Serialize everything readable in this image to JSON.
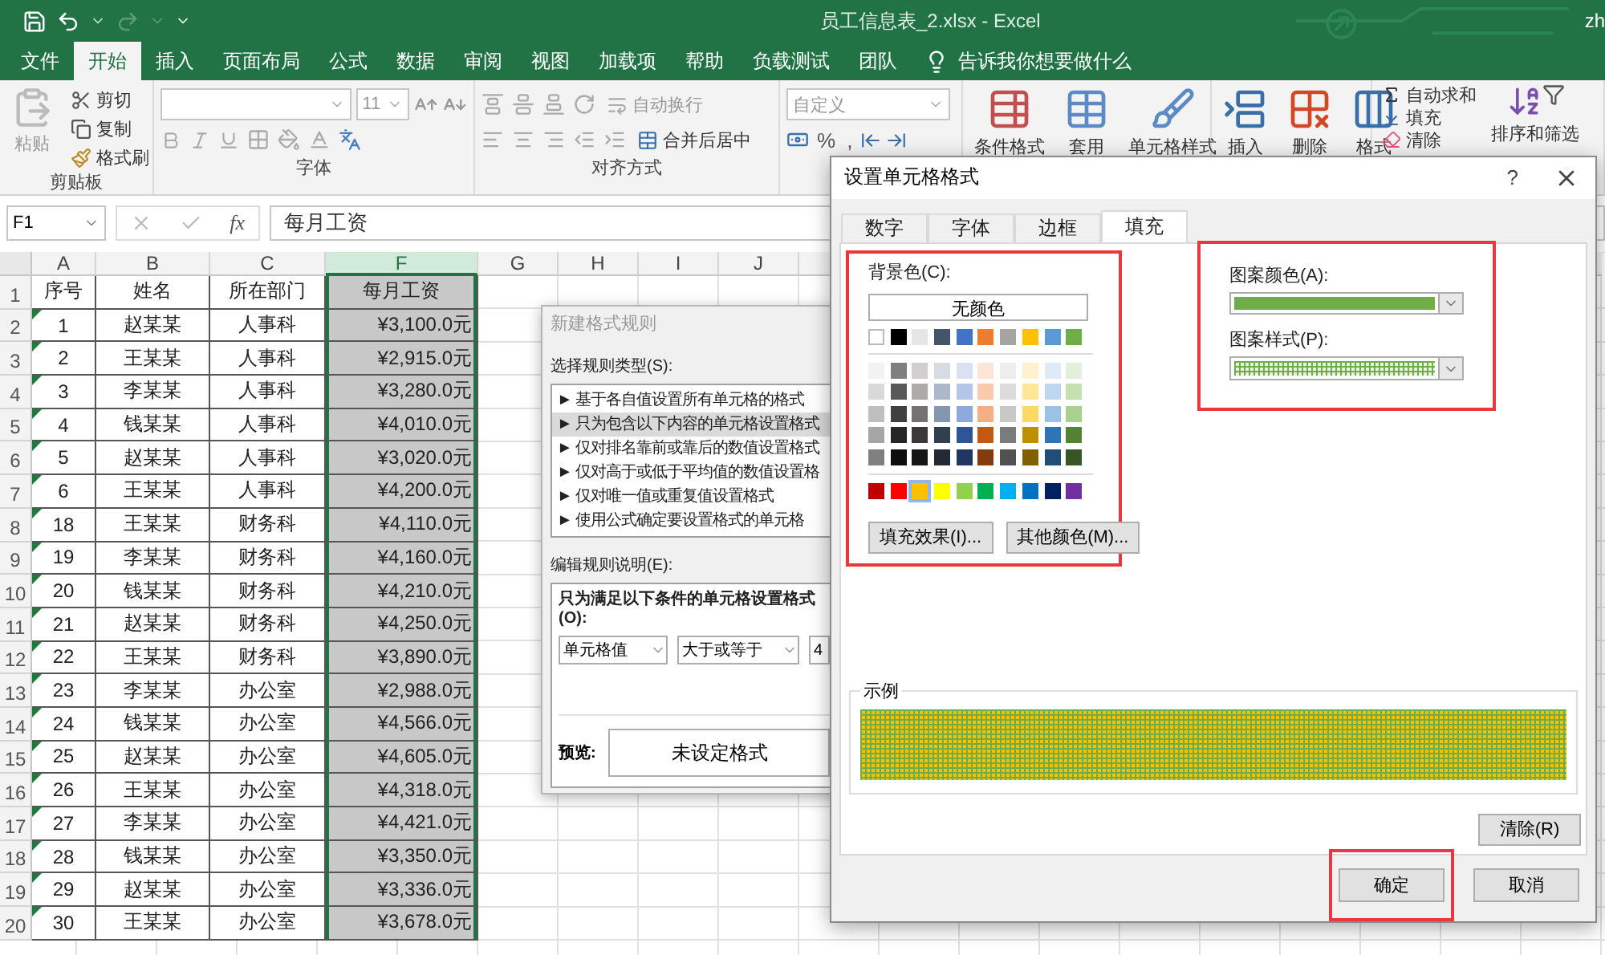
{
  "title_bar": {
    "title": "员工信息表_2.xlsx  -  Excel",
    "user": "zh"
  },
  "ribbon_tabs": [
    {
      "label": "文件",
      "selected": false
    },
    {
      "label": "开始",
      "selected": true
    },
    {
      "label": "插入",
      "selected": false
    },
    {
      "label": "页面布局",
      "selected": false
    },
    {
      "label": "公式",
      "selected": false
    },
    {
      "label": "数据",
      "selected": false
    },
    {
      "label": "审阅",
      "selected": false
    },
    {
      "label": "视图",
      "selected": false
    },
    {
      "label": "加载项",
      "selected": false
    },
    {
      "label": "帮助",
      "selected": false
    },
    {
      "label": "负载测试",
      "selected": false
    },
    {
      "label": "团队",
      "selected": false
    }
  ],
  "tell_me": "告诉我你想要做什么",
  "ribbon": {
    "clipboard": {
      "paste": "粘贴",
      "cut": "剪切",
      "copy": "复制",
      "format_painter": "格式刷",
      "label": "剪贴板"
    },
    "font": {
      "font_size": "11",
      "label": "字体"
    },
    "alignment": {
      "wrap_text": "自动换行",
      "merge_center": "合并后居中",
      "label": "对齐方式"
    },
    "number": {
      "format": "自定义",
      "percent": "%",
      "comma": ","
    },
    "styles": {
      "conditional": "条件格式",
      "table": "套用",
      "cell_styles": "单元格样式"
    },
    "cells": {
      "insert": "插入",
      "delete": "删除",
      "format": "格式"
    },
    "editing": {
      "autosum": "自动求和",
      "fill": "填充",
      "clear": "清除",
      "sort_filter": "排序和筛选"
    }
  },
  "formula_bar": {
    "name_box": "F1",
    "fx": "fx",
    "value": "每月工资"
  },
  "sheet": {
    "columns": [
      {
        "label": "A",
        "selected": false
      },
      {
        "label": "B",
        "selected": false
      },
      {
        "label": "C",
        "selected": false
      },
      {
        "label": "F",
        "selected": true
      },
      {
        "label": "G",
        "selected": false
      },
      {
        "label": "H",
        "selected": false
      },
      {
        "label": "I",
        "selected": false
      },
      {
        "label": "J",
        "selected": false
      }
    ],
    "header_row": {
      "number": "1",
      "cells": [
        "序号",
        "姓名",
        "所在部门",
        "每月工资"
      ]
    },
    "rows": [
      {
        "number": "2",
        "flagged": true,
        "cells": [
          "1",
          "赵某某",
          "人事科",
          "¥3,100.0元"
        ]
      },
      {
        "number": "3",
        "flagged": true,
        "cells": [
          "2",
          "王某某",
          "人事科",
          "¥2,915.0元"
        ]
      },
      {
        "number": "4",
        "flagged": true,
        "cells": [
          "3",
          "李某某",
          "人事科",
          "¥3,280.0元"
        ]
      },
      {
        "number": "5",
        "flagged": true,
        "cells": [
          "4",
          "钱某某",
          "人事科",
          "¥4,010.0元"
        ]
      },
      {
        "number": "6",
        "flagged": true,
        "cells": [
          "5",
          "赵某某",
          "人事科",
          "¥3,020.0元"
        ]
      },
      {
        "number": "7",
        "flagged": true,
        "cells": [
          "6",
          "王某某",
          "人事科",
          "¥4,200.0元"
        ]
      },
      {
        "number": "8",
        "flagged": true,
        "cells": [
          "18",
          "王某某",
          "财务科",
          "¥4,110.0元"
        ]
      },
      {
        "number": "9",
        "flagged": true,
        "cells": [
          "19",
          "李某某",
          "财务科",
          "¥4,160.0元"
        ]
      },
      {
        "number": "10",
        "flagged": true,
        "cells": [
          "20",
          "钱某某",
          "财务科",
          "¥4,210.0元"
        ]
      },
      {
        "number": "11",
        "flagged": true,
        "cells": [
          "21",
          "赵某某",
          "财务科",
          "¥4,250.0元"
        ]
      },
      {
        "number": "12",
        "flagged": true,
        "cells": [
          "22",
          "王某某",
          "财务科",
          "¥3,890.0元"
        ]
      },
      {
        "number": "13",
        "flagged": true,
        "cells": [
          "23",
          "李某某",
          "办公室",
          "¥2,988.0元"
        ]
      },
      {
        "number": "14",
        "flagged": true,
        "cells": [
          "24",
          "钱某某",
          "办公室",
          "¥4,566.0元"
        ]
      },
      {
        "number": "15",
        "flagged": true,
        "cells": [
          "25",
          "赵某某",
          "办公室",
          "¥4,605.0元"
        ]
      },
      {
        "number": "16",
        "flagged": true,
        "cells": [
          "26",
          "王某某",
          "办公室",
          "¥4,318.0元"
        ]
      },
      {
        "number": "17",
        "flagged": true,
        "cells": [
          "27",
          "李某某",
          "办公室",
          "¥4,421.0元"
        ]
      },
      {
        "number": "18",
        "flagged": true,
        "cells": [
          "28",
          "钱某某",
          "办公室",
          "¥3,350.0元"
        ]
      },
      {
        "number": "19",
        "flagged": true,
        "cells": [
          "29",
          "赵某某",
          "办公室",
          "¥3,336.0元"
        ]
      },
      {
        "number": "20",
        "flagged": true,
        "cells": [
          "30",
          "王某某",
          "办公室",
          "¥3,678.0元"
        ]
      }
    ]
  },
  "rule_dialog": {
    "title": "新建格式规则",
    "type_label": "选择规则类型(S):",
    "rule_types": [
      {
        "label": "► 基于各自值设置所有单元格的格式",
        "selected": false
      },
      {
        "label": "► 只为包含以下内容的单元格设置格式",
        "selected": true
      },
      {
        "label": "► 仅对排名靠前或靠后的数值设置格式",
        "selected": false
      },
      {
        "label": "► 仅对高于或低于平均值的数值设置格",
        "selected": false
      },
      {
        "label": "► 仅对唯一值或重复值设置格式",
        "selected": false
      },
      {
        "label": "► 使用公式确定要设置格式的单元格",
        "selected": false
      }
    ],
    "edit_label": "编辑规则说明(E):",
    "condition_title": "只为满足以下条件的单元格设置格式(O):",
    "condition_fields": [
      "单元格值",
      "大于或等于"
    ],
    "value": "4",
    "preview_label": "预览:",
    "preview": "未设定格式"
  },
  "format_dialog": {
    "title": "设置单元格格式",
    "help": "?",
    "tabs": [
      {
        "label": "数字",
        "selected": false
      },
      {
        "label": "字体",
        "selected": false
      },
      {
        "label": "边框",
        "selected": false
      },
      {
        "label": "填充",
        "selected": true
      }
    ],
    "background": {
      "label": "背景色(C):",
      "no_color": "无颜色",
      "highlighted": true,
      "theme_row": [
        {
          "color": "#ffffff",
          "selected": false
        },
        {
          "color": "#000000",
          "selected": false
        },
        {
          "color": "#e7e6e6",
          "selected": false
        },
        {
          "color": "#44546a",
          "selected": false
        },
        {
          "color": "#4472c4",
          "selected": false
        },
        {
          "color": "#ed7d31",
          "selected": false
        },
        {
          "color": "#a5a5a5",
          "selected": false
        },
        {
          "color": "#ffc000",
          "selected": false
        },
        {
          "color": "#5b9bd5",
          "selected": false
        },
        {
          "color": "#70ad47",
          "selected": false
        }
      ],
      "tint_rows": [
        [
          {
            "color": "#f2f2f2",
            "selected": false
          },
          {
            "color": "#7f7f7f",
            "selected": false
          },
          {
            "color": "#d0cece",
            "selected": false
          },
          {
            "color": "#d6dce4",
            "selected": false
          },
          {
            "color": "#d9e1f2",
            "selected": false
          },
          {
            "color": "#fce4d6",
            "selected": false
          },
          {
            "color": "#ededed",
            "selected": false
          },
          {
            "color": "#fff2cc",
            "selected": false
          },
          {
            "color": "#ddebf7",
            "selected": false
          },
          {
            "color": "#e2efda",
            "selected": false
          }
        ],
        [
          {
            "color": "#d9d9d9",
            "selected": false
          },
          {
            "color": "#595959",
            "selected": false
          },
          {
            "color": "#aeaaaa",
            "selected": false
          },
          {
            "color": "#acb9ca",
            "selected": false
          },
          {
            "color": "#b4c6e7",
            "selected": false
          },
          {
            "color": "#f8cbad",
            "selected": false
          },
          {
            "color": "#dbdbdb",
            "selected": false
          },
          {
            "color": "#ffe699",
            "selected": false
          },
          {
            "color": "#bdd7ee",
            "selected": false
          },
          {
            "color": "#c6e0b4",
            "selected": false
          }
        ],
        [
          {
            "color": "#bfbfbf",
            "selected": false
          },
          {
            "color": "#404040",
            "selected": false
          },
          {
            "color": "#757171",
            "selected": false
          },
          {
            "color": "#8497b0",
            "selected": false
          },
          {
            "color": "#8ea9db",
            "selected": false
          },
          {
            "color": "#f4b084",
            "selected": false
          },
          {
            "color": "#c9c9c9",
            "selected": false
          },
          {
            "color": "#ffd966",
            "selected": false
          },
          {
            "color": "#9bc2e6",
            "selected": false
          },
          {
            "color": "#a9d08e",
            "selected": false
          }
        ],
        [
          {
            "color": "#a6a6a6",
            "selected": false
          },
          {
            "color": "#262626",
            "selected": false
          },
          {
            "color": "#3a3838",
            "selected": false
          },
          {
            "color": "#333f4f",
            "selected": false
          },
          {
            "color": "#305496",
            "selected": false
          },
          {
            "color": "#c65911",
            "selected": false
          },
          {
            "color": "#7b7b7b",
            "selected": false
          },
          {
            "color": "#bf8f00",
            "selected": false
          },
          {
            "color": "#2f75b5",
            "selected": false
          },
          {
            "color": "#548235",
            "selected": false
          }
        ],
        [
          {
            "color": "#808080",
            "selected": false
          },
          {
            "color": "#0d0d0d",
            "selected": false
          },
          {
            "color": "#161616",
            "selected": false
          },
          {
            "color": "#222b35",
            "selected": false
          },
          {
            "color": "#203764",
            "selected": false
          },
          {
            "color": "#833c0c",
            "selected": false
          },
          {
            "color": "#525252",
            "selected": false
          },
          {
            "color": "#806000",
            "selected": false
          },
          {
            "color": "#1f4e78",
            "selected": false
          },
          {
            "color": "#375623",
            "selected": false
          }
        ]
      ],
      "standard_row": [
        {
          "color": "#c00000",
          "selected": false
        },
        {
          "color": "#ff0000",
          "selected": false
        },
        {
          "color": "#ffc000",
          "selected": true
        },
        {
          "color": "#ffff00",
          "selected": false
        },
        {
          "color": "#92d050",
          "selected": false
        },
        {
          "color": "#00b050",
          "selected": false
        },
        {
          "color": "#00b0f0",
          "selected": false
        },
        {
          "color": "#0070c0",
          "selected": false
        },
        {
          "color": "#002060",
          "selected": false
        },
        {
          "color": "#7030a0",
          "selected": false
        }
      ],
      "fill_effects": "填充效果(I)...",
      "more_colors": "其他颜色(M)..."
    },
    "pattern": {
      "highlighted": true,
      "color_label": "图案颜色(A):",
      "pattern_color": {
        "color": "#70ad47"
      },
      "style_label": "图案样式(P):"
    },
    "sample_label": "示例",
    "clear": "清除(R)",
    "buttons": [
      {
        "label": "确定",
        "highlighted": true
      },
      {
        "label": "取消",
        "highlighted": false
      }
    ]
  }
}
